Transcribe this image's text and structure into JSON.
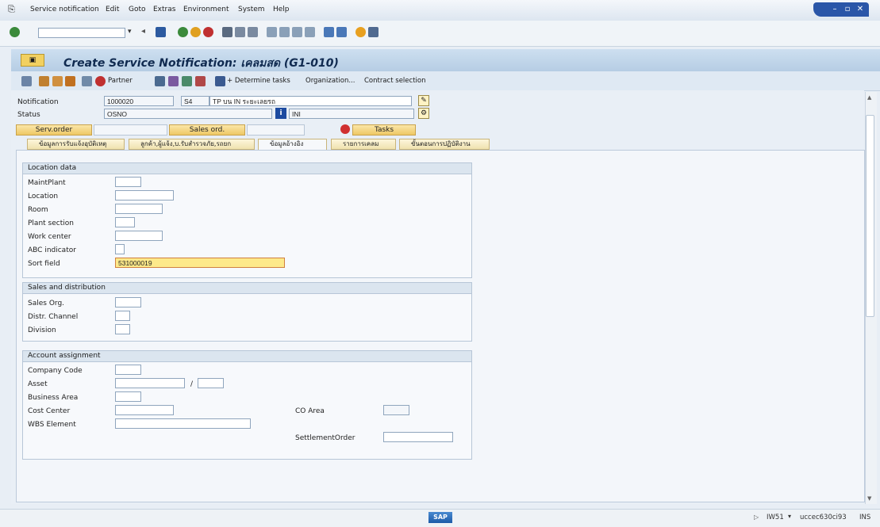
{
  "menu": {
    "items": [
      "Service notification",
      "Edit",
      "Goto",
      "Extras",
      "Environment",
      "System",
      "Help"
    ]
  },
  "toolbar": {
    "command_value": ""
  },
  "title": "Create Service Notification: เคลมสด (G1-010)",
  "app_toolbar": {
    "partner": "Partner",
    "determine_tasks": "+ Determine tasks",
    "organization": "Organization...",
    "contract_selection": "Contract selection"
  },
  "header": {
    "notification_label": "Notification",
    "notification_value": "1000020",
    "type_value": "S4",
    "description_value": "TP บน IN ระยะเลยรถ",
    "status_label": "Status",
    "status_value": "OSNO",
    "status_extra": "INI",
    "serv_order_button": "Serv.order",
    "sales_ord_button": "Sales ord.",
    "tasks_button": "Tasks"
  },
  "tabs": [
    {
      "label": "ข้อมูลการรับแจ้งอุบัติเหตุ"
    },
    {
      "label": "ลูกค้า,ผู้แจ้ง,บ.รับสำรวจภัย,รถยก"
    },
    {
      "label": "ข้อมูลอ้างอิง"
    },
    {
      "label": "รายการเคลม"
    },
    {
      "label": "ขั้นตอนการปฏิบัติงาน"
    }
  ],
  "location_data": {
    "title": "Location data",
    "fields": [
      {
        "label": "MaintPlant",
        "value": ""
      },
      {
        "label": "Location",
        "value": ""
      },
      {
        "label": "Room",
        "value": ""
      },
      {
        "label": "Plant section",
        "value": ""
      },
      {
        "label": "Work center",
        "value": ""
      },
      {
        "label": "ABC indicator",
        "value": ""
      },
      {
        "label": "Sort field",
        "value": "531000019"
      }
    ]
  },
  "sales_distribution": {
    "title": "Sales and distribution",
    "fields": [
      {
        "label": "Sales Org.",
        "value": ""
      },
      {
        "label": "Distr. Channel",
        "value": ""
      },
      {
        "label": "Division",
        "value": ""
      }
    ]
  },
  "account_assignment": {
    "title": "Account assignment",
    "fields": [
      {
        "label": "Company Code",
        "value": ""
      },
      {
        "label": "Asset",
        "value": ""
      },
      {
        "label": "Business Area",
        "value": ""
      },
      {
        "label": "Cost Center",
        "value": ""
      },
      {
        "label": "WBS Element",
        "value": ""
      }
    ],
    "asset_separator": "/",
    "co_area_label": "CO Area",
    "settlement_order_label": "SettlementOrder"
  },
  "status_bar": {
    "sap_logo": "SAP",
    "transaction": "IW51",
    "server": "uccec630ci93",
    "mode": "INS"
  },
  "colors": {
    "accent": "#2a56a8",
    "title_bg": "#b6cde4",
    "highlight_field": "#fde98a"
  }
}
